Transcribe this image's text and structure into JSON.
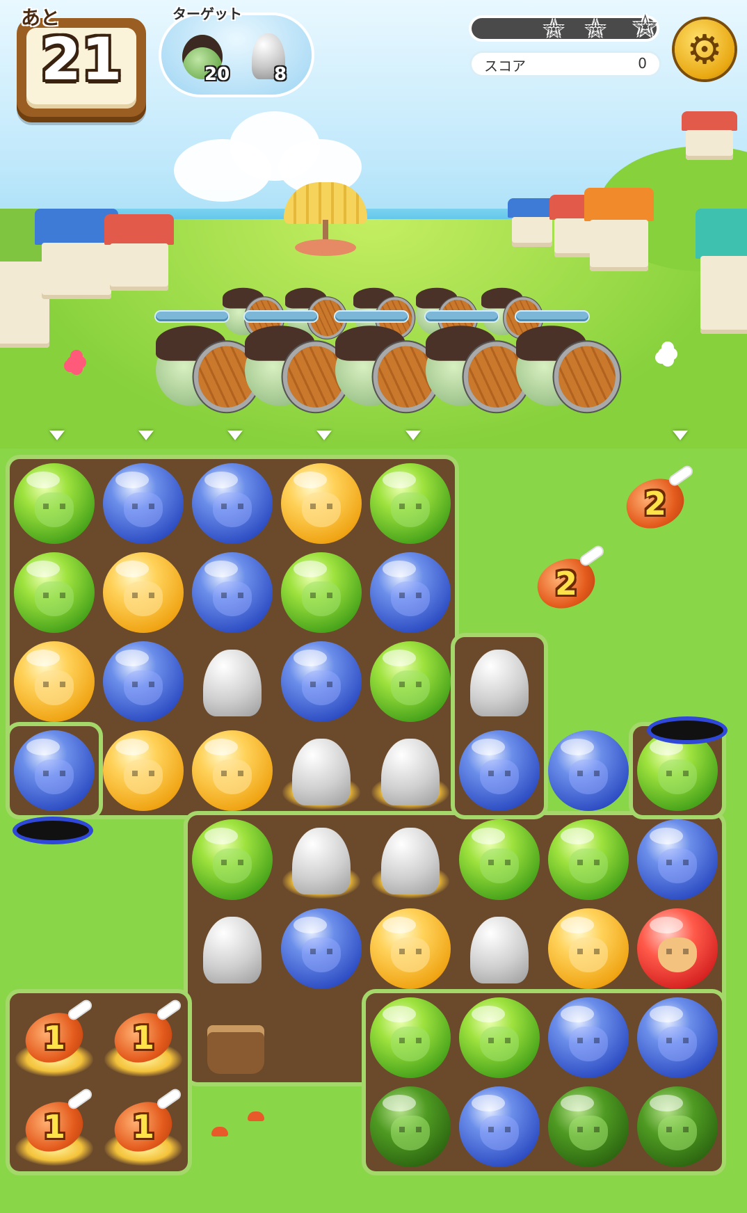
{
  "hud": {
    "moves_label": "あと",
    "moves_value": "21",
    "target_label": "ターゲット",
    "targets": [
      {
        "icon": "zombie-enemy-icon",
        "count": "20"
      },
      {
        "icon": "rock-icon",
        "count": "8"
      }
    ],
    "stars": [
      "☆",
      "☆",
      "☆"
    ],
    "score_progress": 0,
    "score_label": "スコア",
    "score_value": "0",
    "settings_icon": "gear-icon"
  },
  "board": {
    "enemies": 10,
    "colors": {
      "green": "#4aa51c",
      "blue": "#2f4fc4",
      "yellow": "#f0a414",
      "red": "#d21e1e"
    },
    "meat_labels": [
      "2",
      "2",
      "1",
      "1",
      "1",
      "1"
    ]
  }
}
